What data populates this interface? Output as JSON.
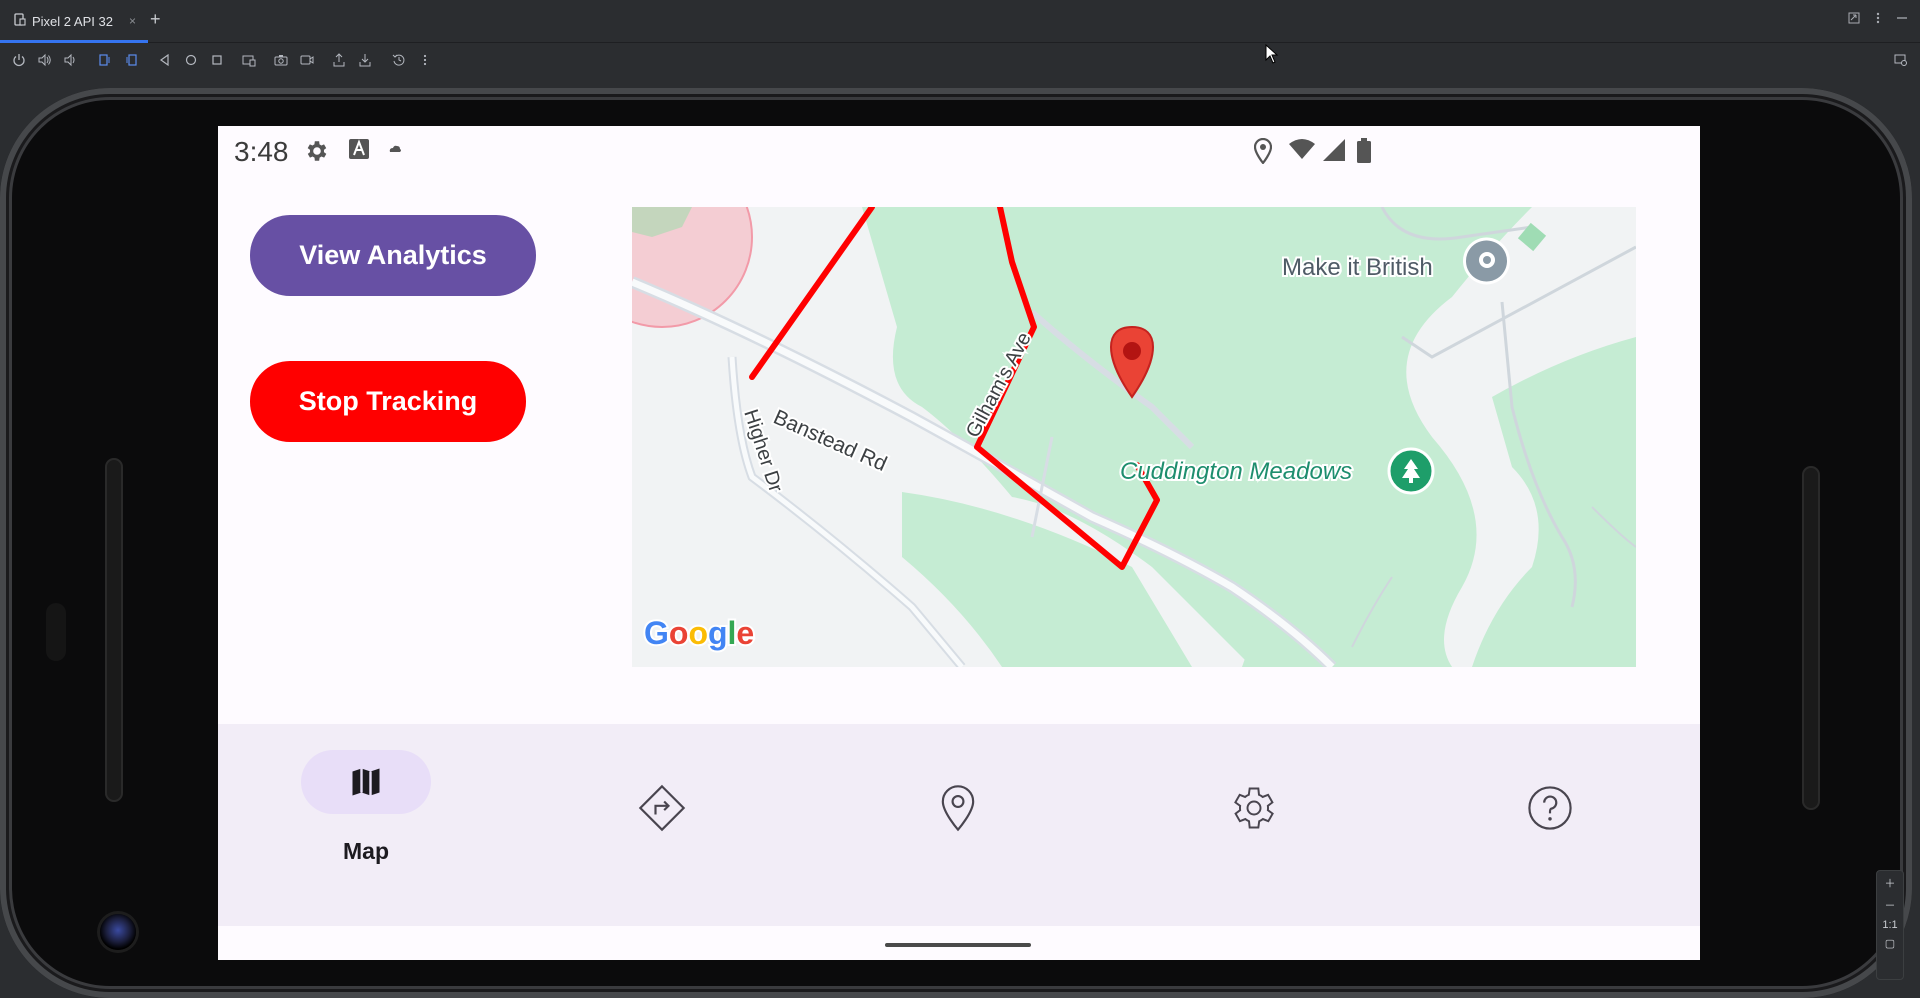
{
  "ide": {
    "tab_title": "Pixel 2 API 32",
    "tab_close": "×",
    "tab_add": "+",
    "zoom_ratio": "1:1"
  },
  "status_bar": {
    "time": "3:48",
    "icons": [
      "gear-icon",
      "font-a-icon",
      "cloud-icon",
      "location-icon",
      "wifi-icon",
      "signal-icon",
      "battery-icon"
    ]
  },
  "buttons": {
    "view_analytics": "View Analytics",
    "stop_tracking": "Stop Tracking"
  },
  "map": {
    "labels": {
      "banstead_rd": "Banstead Rd",
      "higher_dr": "Higher Dr",
      "gilhams_ave": "Gilham's Ave",
      "make_it_british": "Make it British",
      "cuddington_meadows": "Cuddington Meadows",
      "google": "Google"
    },
    "route_color": "#ff0000",
    "marker_color": "#ea4335"
  },
  "bottom_nav": {
    "items": [
      {
        "label": "Map",
        "icon": "map-icon",
        "selected": true
      },
      {
        "label": "",
        "icon": "directions-icon",
        "selected": false
      },
      {
        "label": "",
        "icon": "location-pin-icon",
        "selected": false
      },
      {
        "label": "",
        "icon": "settings-gear-icon",
        "selected": false
      },
      {
        "label": "",
        "icon": "help-icon",
        "selected": false
      }
    ]
  },
  "colors": {
    "primary": "#6750a4",
    "stop": "#ff0000",
    "nav_bg": "#f2edf7",
    "nav_pill": "#e8def8",
    "park_green": "#c5ecd3"
  }
}
